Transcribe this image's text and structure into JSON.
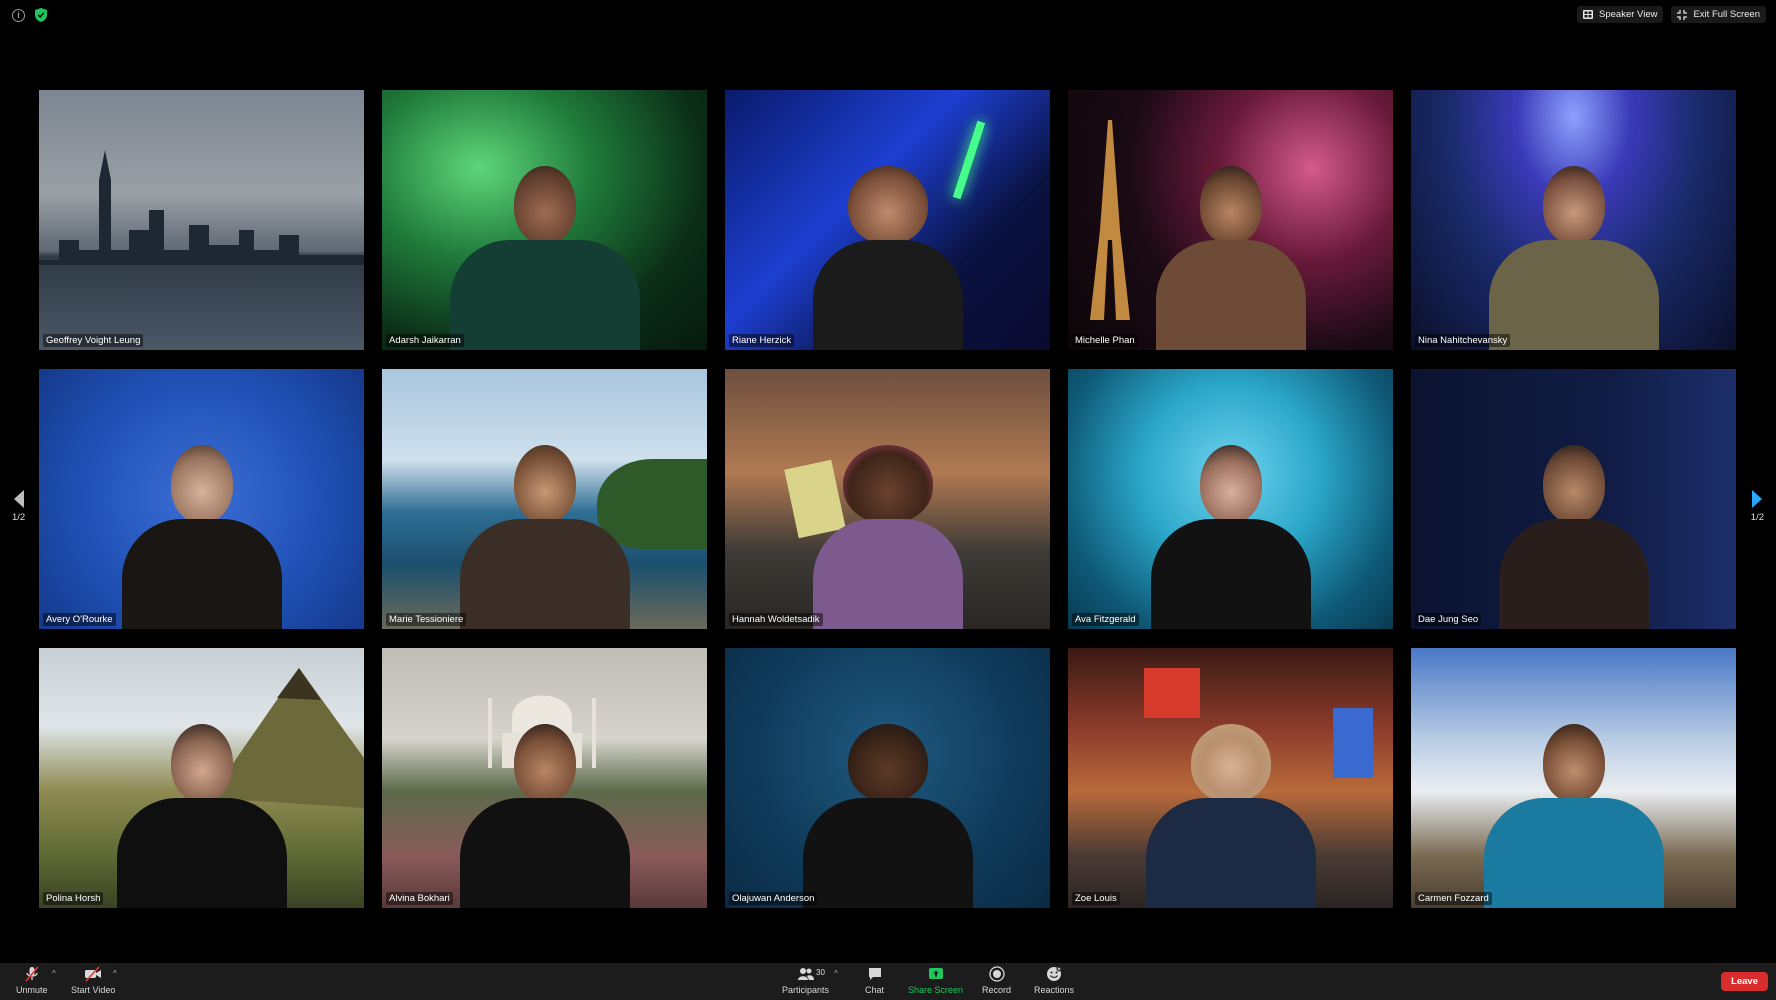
{
  "topbar": {
    "speaker_view_label": "Speaker View",
    "exit_fullscreen_label": "Exit Full Screen"
  },
  "pager": {
    "left_label": "1/2",
    "right_label": "1/2"
  },
  "participants": [
    {
      "name": "Geoffrey Voight Leung"
    },
    {
      "name": "Adarsh Jaikarran"
    },
    {
      "name": "Riane Herzick"
    },
    {
      "name": "Michelle Phan"
    },
    {
      "name": "Nina Nahitchevansky"
    },
    {
      "name": "Avery O'Rourke"
    },
    {
      "name": "Marie Tessioniere"
    },
    {
      "name": "Hannah Woldetsadik"
    },
    {
      "name": "Ava Fitzgerald"
    },
    {
      "name": "Dae Jung Seo"
    },
    {
      "name": "Polina Horsh"
    },
    {
      "name": "Alvina Bokhari"
    },
    {
      "name": "Olajuwan Anderson"
    },
    {
      "name": "Zoe Louis"
    },
    {
      "name": "Carmen Fozzard"
    }
  ],
  "toolbar": {
    "unmute_label": "Unmute",
    "start_video_label": "Start Video",
    "participants_label": "Participants",
    "participants_count": "30",
    "chat_label": "Chat",
    "share_screen_label": "Share Screen",
    "record_label": "Record",
    "reactions_label": "Reactions",
    "leave_label": "Leave"
  },
  "colors": {
    "share_green": "#21c55d",
    "leave_red": "#d92c2c",
    "toolbar_bg": "#1c1c1c"
  }
}
